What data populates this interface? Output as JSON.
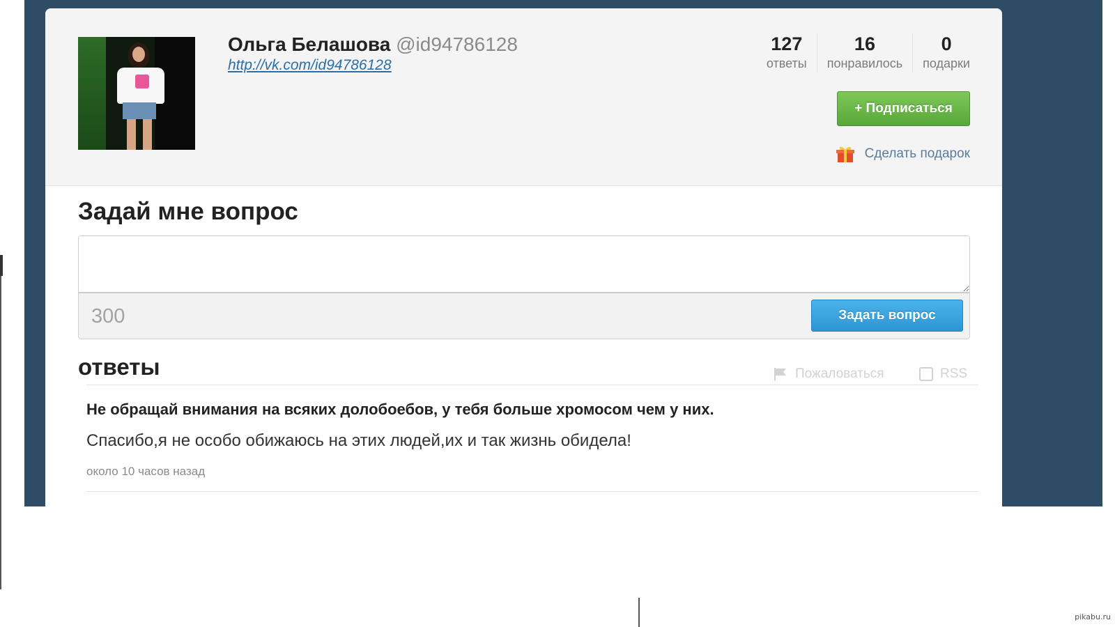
{
  "profile": {
    "name": "Ольга Белашова",
    "handle": "@id94786128",
    "link": "http://vk.com/id94786128",
    "avatar_icon": "user-photo"
  },
  "stats": [
    {
      "value": "127",
      "label": "ответы"
    },
    {
      "value": "16",
      "label": "понравилось"
    },
    {
      "value": "0",
      "label": "подарки"
    }
  ],
  "actions": {
    "follow_label": "+ Подписаться",
    "gift_label": "Сделать подарок",
    "gift_icon": "gift-icon"
  },
  "ask": {
    "title": "Задай мне вопрос",
    "input_value": "",
    "char_count": "300",
    "submit_label": "Задать вопрос"
  },
  "answers": {
    "title": "ответы",
    "report_label": "Пожаловаться",
    "rss_label": "RSS",
    "items": [
      {
        "question": "Не обращай внимания на всяких долобоебов, у тебя больше хромосом чем у них.",
        "answer": "Спасибо,я не особо обижаюсь на этих людей,их и так жизнь обидела!",
        "time": "около 10 часов назад"
      }
    ]
  },
  "watermark": "pikabu.ru",
  "colors": {
    "backdrop": "#2f4c66",
    "follow_green": "#58a73a",
    "ask_blue": "#2d95d3",
    "link_blue": "#2b6ea5"
  }
}
